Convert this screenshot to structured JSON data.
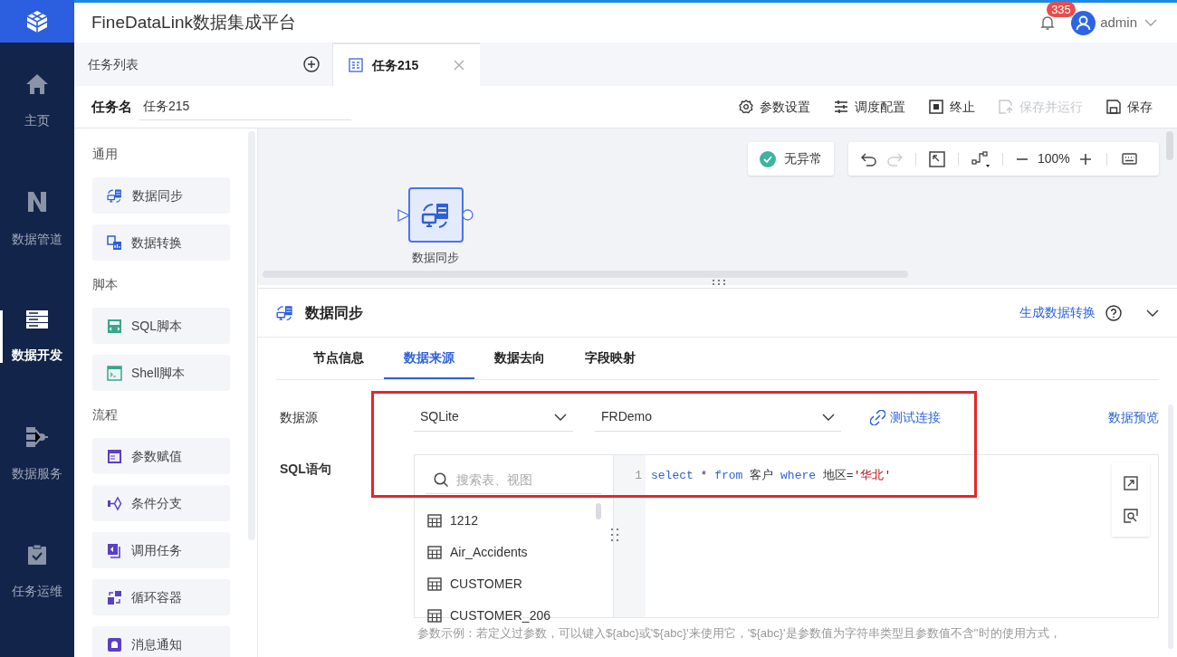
{
  "header": {
    "app_title": "FineDataLink数据集成平台",
    "notification_count": "335",
    "user": "admin"
  },
  "nav": [
    {
      "label": "主页",
      "selected": false
    },
    {
      "label": "数据管道",
      "selected": false
    },
    {
      "label": "数据开发",
      "selected": true
    },
    {
      "label": "数据服务",
      "selected": false
    },
    {
      "label": "任务运维",
      "selected": false
    }
  ],
  "tabs": [
    {
      "label": "任务列表",
      "kind": "list",
      "selected": false
    },
    {
      "label": "任务215",
      "kind": "task",
      "selected": true
    }
  ],
  "task_name": {
    "label": "任务名",
    "value": "任务215"
  },
  "actions": [
    {
      "label": "参数设置",
      "disabled": false
    },
    {
      "label": "调度配置",
      "disabled": false
    },
    {
      "label": "终止",
      "disabled": false
    },
    {
      "label": "保存并运行",
      "disabled": true
    },
    {
      "label": "保存",
      "disabled": false
    }
  ],
  "palette": [
    {
      "title": "通用",
      "items": [
        {
          "label": "数据同步"
        },
        {
          "label": "数据转换"
        }
      ]
    },
    {
      "title": "脚本",
      "items": [
        {
          "label": "SQL脚本"
        },
        {
          "label": "Shell脚本"
        }
      ]
    },
    {
      "title": "流程",
      "items": [
        {
          "label": "参数赋值"
        },
        {
          "label": "条件分支"
        },
        {
          "label": "调用任务"
        },
        {
          "label": "循环容器"
        },
        {
          "label": "消息通知"
        }
      ]
    }
  ],
  "canvas": {
    "status": "无异常",
    "zoom": "100%",
    "node": {
      "label": "数据同步",
      "selected": true
    }
  },
  "panel": {
    "title": "数据同步",
    "generate_link": "生成数据转换",
    "tabs": [
      {
        "label": "节点信息",
        "selected": false
      },
      {
        "label": "数据来源",
        "selected": true
      },
      {
        "label": "数据去向",
        "selected": false
      },
      {
        "label": "字段映射",
        "selected": false
      }
    ],
    "datasource_label": "数据源",
    "selects": [
      "SQLite",
      "FRDemo"
    ],
    "test_link": "测试连接",
    "preview_link": "数据预览",
    "sql_label": "SQL语句",
    "search_placeholder": "搜索表、视图",
    "tables": [
      "1212",
      "Air_Accidents",
      "CUSTOMER",
      "CUSTOMER_206"
    ],
    "line_number": "1",
    "code": [
      {
        "text": "select",
        "kind": "keyword"
      },
      {
        "text": " * ",
        "kind": "plain"
      },
      {
        "text": "from",
        "kind": "keyword"
      },
      {
        "text": " 客户 ",
        "kind": "plain"
      },
      {
        "text": "where",
        "kind": "keyword"
      },
      {
        "text": " 地区=",
        "kind": "plain"
      },
      {
        "text": "'华北'",
        "kind": "string"
      }
    ],
    "hint": "参数示例：若定义过参数，可以键入${abc}或'${abc}'来使用它，'${abc}'是参数值为字符串类型且参数值不含''时的使用方式，"
  }
}
